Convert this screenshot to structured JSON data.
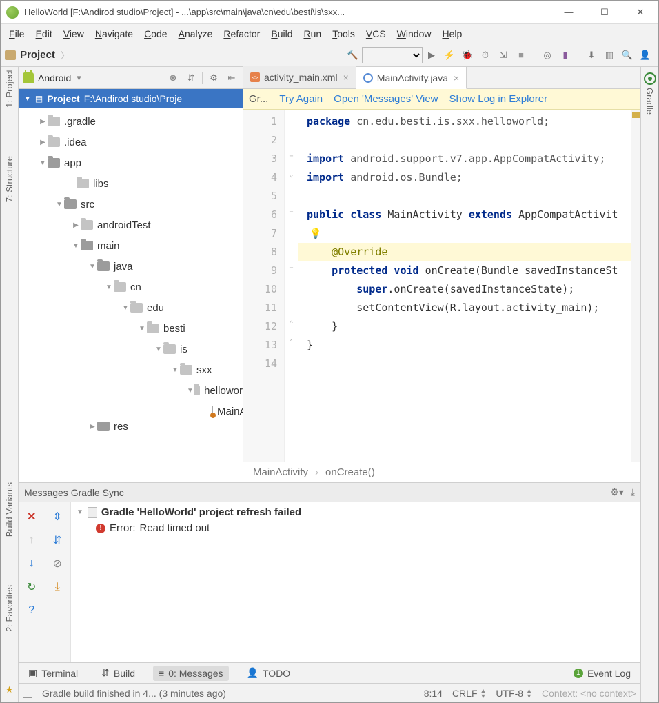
{
  "titlebar": {
    "title": "HelloWorld [F:\\Andirod studio\\Project] - ...\\app\\src\\main\\java\\cn\\edu\\besti\\is\\sxx..."
  },
  "menu": [
    "File",
    "Edit",
    "View",
    "Navigate",
    "Code",
    "Analyze",
    "Refactor",
    "Build",
    "Run",
    "Tools",
    "VCS",
    "Window",
    "Help"
  ],
  "breadcrumb": {
    "label": "Project"
  },
  "projectPanel": {
    "viewName": "Android",
    "rootLabel": "Project",
    "rootPath": "F:\\Andirod studio\\Proje",
    "tree": [
      {
        "indent": 28,
        "arrow": "▶",
        "label": ".gradle"
      },
      {
        "indent": 28,
        "arrow": "▶",
        "label": ".idea"
      },
      {
        "indent": 28,
        "arrow": "▼",
        "label": "app",
        "dark": true
      },
      {
        "indent": 70,
        "arrow": "",
        "label": "libs"
      },
      {
        "indent": 52,
        "arrow": "▼",
        "label": "src",
        "dark": true
      },
      {
        "indent": 76,
        "arrow": "▶",
        "label": "androidTest"
      },
      {
        "indent": 76,
        "arrow": "▼",
        "label": "main",
        "dark": true
      },
      {
        "indent": 100,
        "arrow": "▼",
        "label": "java",
        "dark": true
      },
      {
        "indent": 124,
        "arrow": "▼",
        "label": "cn"
      },
      {
        "indent": 148,
        "arrow": "▼",
        "label": "edu"
      },
      {
        "indent": 172,
        "arrow": "▼",
        "label": "besti"
      },
      {
        "indent": 196,
        "arrow": "▼",
        "label": "is"
      },
      {
        "indent": 220,
        "arrow": "▼",
        "label": "sxx"
      },
      {
        "indent": 244,
        "arrow": "▼",
        "label": "hellowor"
      },
      {
        "indent": 280,
        "arrow": "",
        "label": "MainA",
        "file": true
      },
      {
        "indent": 100,
        "arrow": "▶",
        "label": "res",
        "dark": true,
        "cut": true
      }
    ]
  },
  "tabs": [
    {
      "label": "activity_main.xml",
      "active": false,
      "icon": "xml"
    },
    {
      "label": "MainActivity.java",
      "active": true,
      "icon": "java"
    }
  ],
  "banner": {
    "prefix": "Gr...",
    "links": [
      "Try Again",
      "Open 'Messages' View",
      "Show Log in Explorer"
    ]
  },
  "code": {
    "lines": [
      {
        "n": 1,
        "html": "<span class='kw'>package</span> <span class='pkg'>cn.edu.besti.is.sxx.helloworld;</span>"
      },
      {
        "n": 2,
        "html": ""
      },
      {
        "n": 3,
        "html": "<span class='kw'>import</span> <span class='pkg'>android.support.v7.app.AppCompatActivity;</span>",
        "fold": "−"
      },
      {
        "n": 4,
        "html": "<span class='kw'>import</span> <span class='pkg'>android.os.Bundle;</span>",
        "fold": "⌄"
      },
      {
        "n": 5,
        "html": ""
      },
      {
        "n": 6,
        "html": "<span class='kw'>public class</span> <span class='ident'>MainActivity</span> <span class='kw'>extends</span> <span class='ident'>AppCompatActivit</span>",
        "fold": "−"
      },
      {
        "n": 7,
        "html": "<span class='bulb'>💡</span>"
      },
      {
        "n": 8,
        "html": "    <span class='ann'>@Override</span>",
        "hl": true
      },
      {
        "n": 9,
        "html": "    <span class='kw'>protected void</span> <span class='ident'>onCreate</span>(Bundle savedInstanceSt",
        "fold": "−"
      },
      {
        "n": 10,
        "html": "        <span class='kw'>super</span>.onCreate(savedInstanceState);"
      },
      {
        "n": 11,
        "html": "        setContentView(R.layout.<span class='ident'>activity_main</span>);"
      },
      {
        "n": 12,
        "html": "    }",
        "fold": "⌃"
      },
      {
        "n": 13,
        "html": "}",
        "fold": "⌃"
      },
      {
        "n": 14,
        "html": ""
      }
    ],
    "crumbs": [
      "MainActivity",
      "onCreate()"
    ]
  },
  "messages": {
    "title": "Messages Gradle Sync",
    "headline": "Gradle 'HelloWorld' project refresh failed",
    "errorLabel": "Error:",
    "errorText": "Read timed out"
  },
  "bottomTabs": {
    "items": [
      {
        "label": "Terminal",
        "icon": "▣"
      },
      {
        "label": "Build",
        "icon": "⇵"
      },
      {
        "label": "0: Messages",
        "icon": "≡",
        "active": true
      },
      {
        "label": "TODO",
        "icon": "👤"
      }
    ],
    "eventCount": "1",
    "eventLabel": "Event Log"
  },
  "status": {
    "message": "Gradle build finished in 4... (3 minutes ago)",
    "pos": "8:14",
    "eol": "CRLF",
    "enc": "UTF-8",
    "context": "Context: <no context>"
  },
  "leftGutter": [
    "1: Project",
    "7: Structure",
    "Build Variants",
    "2: Favorites"
  ],
  "rightGutter": "Gradle"
}
